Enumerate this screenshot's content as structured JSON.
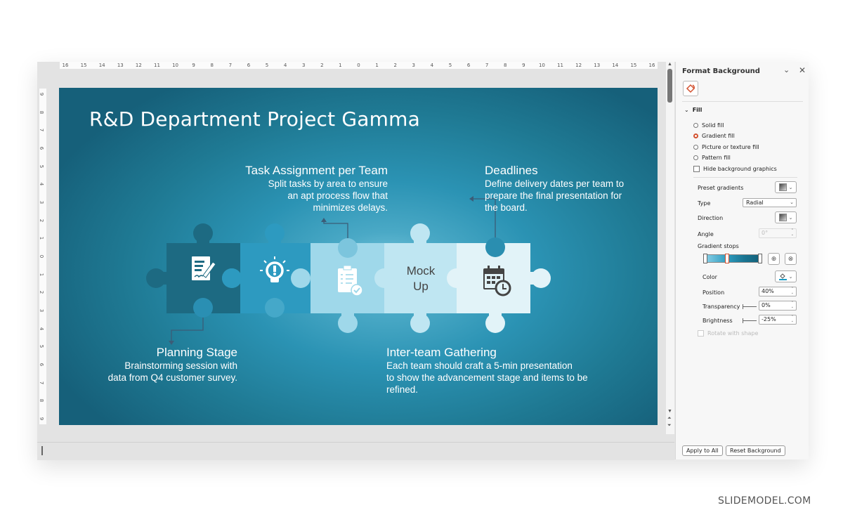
{
  "ruler": {
    "horizontal": [
      "16",
      "15",
      "14",
      "13",
      "12",
      "11",
      "10",
      "9",
      "8",
      "7",
      "6",
      "5",
      "4",
      "3",
      "2",
      "1",
      "0",
      "1",
      "2",
      "3",
      "4",
      "5",
      "6",
      "7",
      "8",
      "9",
      "10",
      "11",
      "12",
      "13",
      "14",
      "15",
      "16"
    ],
    "vertical": [
      "9",
      "8",
      "7",
      "6",
      "5",
      "4",
      "3",
      "2",
      "1",
      "0",
      "1",
      "2",
      "3",
      "4",
      "5",
      "6",
      "7",
      "8",
      "9"
    ]
  },
  "slide": {
    "title": "R&D Department Project Gamma",
    "colors": {
      "puzzle_dark": "#1d6a82",
      "puzzle_mid": "#2d9ac0",
      "puzzle_light": "#9fd8ea",
      "puzzle_lighter": "#bfe6f2",
      "puzzle_lightest": "#e2f3f8",
      "connector": "#3b5c77"
    },
    "pieces": [
      {
        "name": "planning",
        "icon": "document-signature-icon"
      },
      {
        "name": "idea",
        "icon": "lightbulb-icon"
      },
      {
        "name": "tasks",
        "icon": "clipboard-check-icon"
      },
      {
        "name": "mockup",
        "text_line1": "Mock",
        "text_line2": "Up"
      },
      {
        "name": "deadlines",
        "icon": "calendar-clock-icon"
      }
    ],
    "labels": {
      "task_assignment": {
        "heading": "Task Assignment per Team",
        "lines": [
          "Split tasks by area to ensure",
          "an apt process flow that",
          "minimizes delays."
        ]
      },
      "deadlines": {
        "heading": "Deadlines",
        "lines": [
          "Define delivery dates per team to",
          "prepare the final presentation for",
          "the board."
        ]
      },
      "planning": {
        "heading": "Planning Stage",
        "lines": [
          "Brainstorming session with",
          "data from Q4 customer survey."
        ]
      },
      "gathering": {
        "heading": "Inter-team Gathering",
        "lines": [
          "Each team should craft a 5-min presentation",
          "to show the advancement stage and items to be",
          "refined."
        ]
      }
    }
  },
  "pane": {
    "title": "Format Background",
    "collapse_icon": "chevron-down-icon",
    "close_icon": "close-icon",
    "tab_icon": "paint-bucket-icon",
    "section": "Fill",
    "fill_options": [
      {
        "label": "Solid fill",
        "selected": false
      },
      {
        "label": "Gradient fill",
        "selected": true
      },
      {
        "label": "Picture or texture fill",
        "selected": false
      },
      {
        "label": "Pattern fill",
        "selected": false
      }
    ],
    "hide_graphics_label": "Hide background graphics",
    "preset_gradients_label": "Preset gradients",
    "type_label": "Type",
    "type_value": "Radial",
    "direction_label": "Direction",
    "angle_label": "Angle",
    "angle_value": "0°",
    "gradient_stops_label": "Gradient stops",
    "gradient_stops_positions_pct": [
      0,
      40,
      100
    ],
    "selected_stop_index": 1,
    "color_label": "Color",
    "color_value": "#1a9bc4",
    "position_label": "Position",
    "position_value": "40%",
    "transparency_label": "Transparency",
    "transparency_value": "0%",
    "brightness_label": "Brightness",
    "brightness_value": "-25%",
    "rotate_label": "Rotate with shape",
    "apply_all_label": "Apply to All",
    "reset_label": "Reset Background"
  },
  "watermark": "SLIDEMODEL.COM"
}
